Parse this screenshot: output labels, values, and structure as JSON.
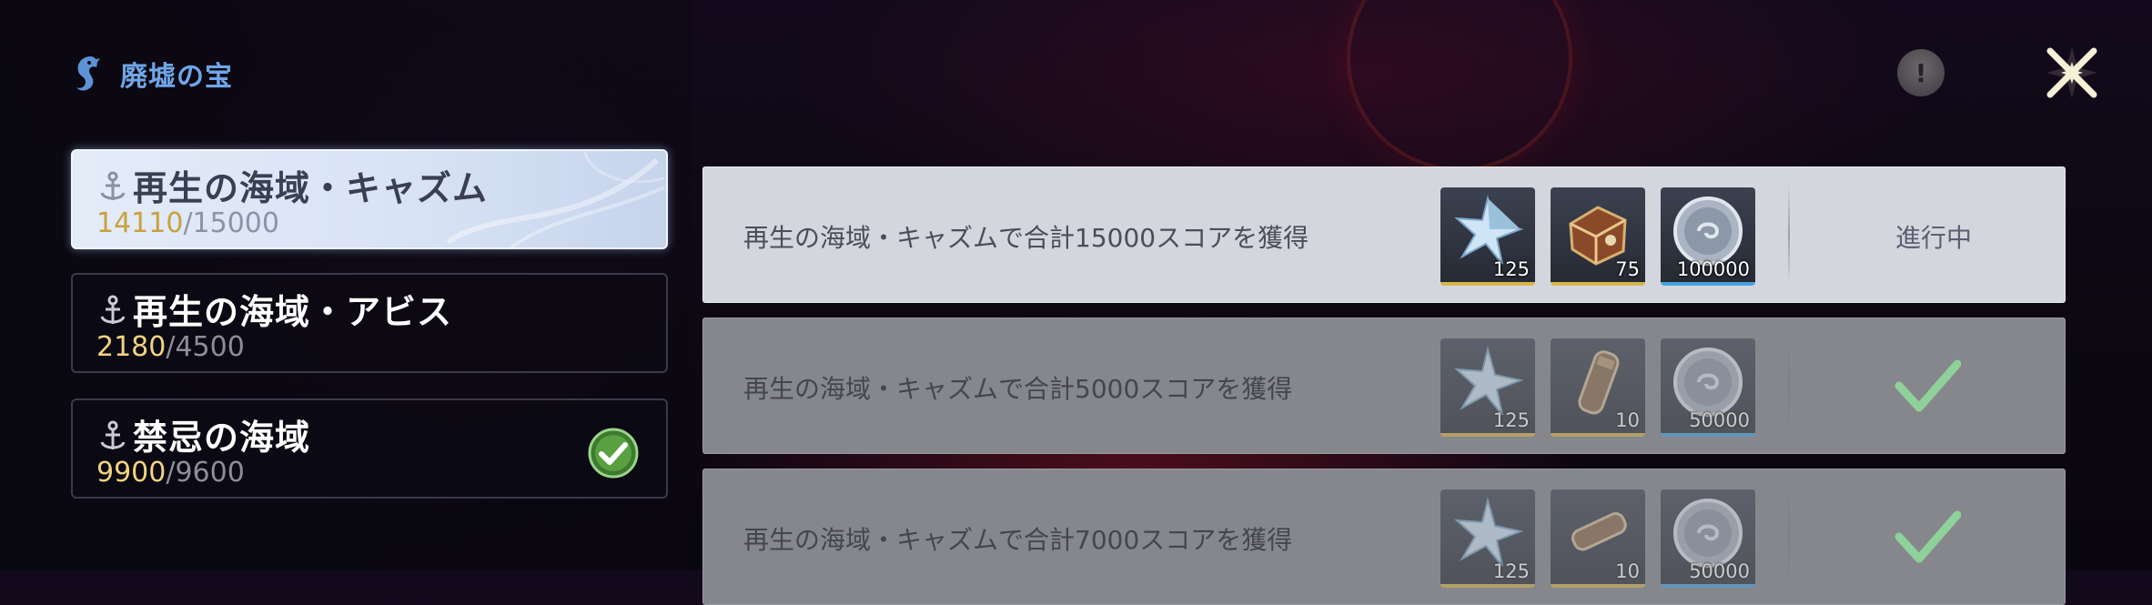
{
  "header": {
    "title": "廃墟の宝"
  },
  "regions": [
    {
      "name": "再生の海域・キャズム",
      "current": "14110",
      "sep": "/",
      "max": "15000",
      "active": true,
      "completed": false
    },
    {
      "name": "再生の海域・アビス",
      "current": "2180",
      "sep": "/",
      "max": "4500",
      "active": false,
      "completed": false
    },
    {
      "name": "禁忌の海域",
      "current": "9900",
      "sep": "/",
      "max": "9600",
      "active": false,
      "completed": true
    }
  ],
  "missions": [
    {
      "text": "再生の海域・キャズムで合計15000スコアを獲得",
      "rewards": [
        {
          "icon": "star-crystal-icon",
          "qty": "125",
          "rarity": "gold"
        },
        {
          "icon": "treasure-crate-icon",
          "qty": "75",
          "rarity": "gold"
        },
        {
          "icon": "silver-coin-icon",
          "qty": "100000",
          "rarity": "blue"
        }
      ],
      "status": "進行中"
    },
    {
      "text": "再生の海域・キャズムで合計5000スコアを獲得",
      "rewards": [
        {
          "icon": "star-crystal-icon",
          "qty": "125",
          "rarity": "gold"
        },
        {
          "icon": "scroll-bundle-icon",
          "qty": "10",
          "rarity": "gold"
        },
        {
          "icon": "silver-coin-icon",
          "qty": "50000",
          "rarity": "blue"
        }
      ],
      "status": "completed"
    },
    {
      "text": "再生の海域・キャズムで合計7000スコアを獲得",
      "rewards": [
        {
          "icon": "star-crystal-icon",
          "qty": "125",
          "rarity": "gold"
        },
        {
          "icon": "scroll-bundle-icon",
          "qty": "10",
          "rarity": "gold"
        },
        {
          "icon": "silver-coin-icon",
          "qty": "50000",
          "rarity": "blue"
        }
      ],
      "status": "completed"
    }
  ],
  "colors": {
    "accent_blue": "#6fa6e8",
    "progress_gold": "#f2d480",
    "check_green": "#8fd19a"
  }
}
